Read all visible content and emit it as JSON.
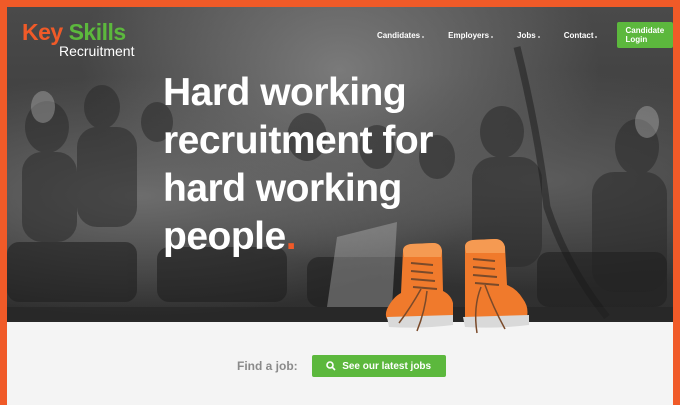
{
  "logo": {
    "key": "Key",
    "skills": "Skills",
    "tagline": "Recruitment"
  },
  "nav": {
    "items": [
      {
        "label": "Candidates"
      },
      {
        "label": "Employers"
      },
      {
        "label": "Jobs"
      },
      {
        "label": "Contact"
      }
    ],
    "login_label": "Candidate Login"
  },
  "hero": {
    "lines": [
      "Hard working",
      "recruitment for",
      "hard working",
      "people"
    ],
    "period": "."
  },
  "find_job": {
    "label": "Find a job:",
    "button_label": "See our latest jobs",
    "button_icon": "search-icon"
  },
  "colors": {
    "brand_orange": "#f05a28",
    "brand_green": "#5cb83d"
  }
}
